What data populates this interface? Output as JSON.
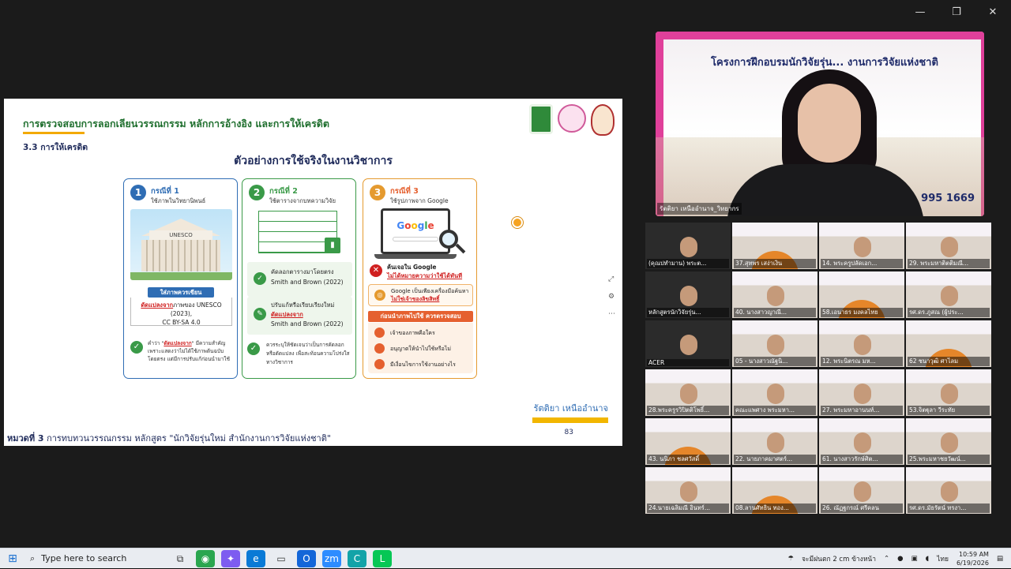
{
  "window": {
    "minimize": "—",
    "maximize": "❐",
    "close": "✕"
  },
  "slide": {
    "title": "การตรวจสอบการลอกเลียนวรรณกรรม หลักการอ้างอิง และการให้เครดิต",
    "section": "3.3 การให้เครดิต",
    "heading": "ตัวอย่างการใช้จริงในงานวิชาการ",
    "card1": {
      "num": "1",
      "title": "กรณีที่ 1",
      "subtitle": "ใช้ภาพในวิทยานิพนธ์",
      "image_text": "UNESCO",
      "label": "ใส่ภาพควรเขียน",
      "credit_red": "ดัดแปลงจาก",
      "credit_text": "ภาพของ UNESCO (2023),",
      "credit_license": "CC BY-SA 4.0",
      "note_pre": "คำว่า \"",
      "note_red": "ดัดแปลงจาก",
      "note_post": "\" มีความสำคัญ เพราะแสดงว่าไม่ได้ใช้ภาพต้นฉบับโดยตรง แต่มีการปรับแก้ก่อนนำมาใช้"
    },
    "card2": {
      "num": "2",
      "title": "กรณีที่ 2",
      "subtitle": "ใช้ตารางจากบทความวิจัย",
      "box1_line1": "คัดลอกตารางมาโดยตรง",
      "box1_line2": "Smith and Brown (2022)",
      "box2_line1": "ปรับแก้หรือเรียบเรียงใหม่",
      "box2_red": "ดัดแปลงจาก",
      "box2_line3": "Smith and Brown (2022)",
      "note": "ควรระบุให้ชัดเจนว่าเป็นการคัดลอก หรือดัดแปลง เพื่อสะท้อนความโปร่งใส ทางวิชาการ"
    },
    "card3": {
      "num": "3",
      "title": "กรณีที่ 3",
      "subtitle": "ใช้รูปภาพจาก Google",
      "google": "Google",
      "found_line1": "ค้นเจอใน Google",
      "found_line2": "ไม่ได้หมายความว่าใช้ได้ทันที",
      "box_line1": "Google เป็นเพียงเครื่องมือค้นหา",
      "box_line2": "ไม่ใช่เจ้าของลิขสิทธิ์",
      "bar": "ก่อนนำภาพไปใช้ ควรตรวจสอบ",
      "items": [
        "เจ้าของภาพคือใคร",
        "อนุญาตให้นำไปใช้หรือไม่",
        "มีเงื่อนไขการใช้งานอย่างไร"
      ]
    },
    "author": "รัตติยา เหนืออำนาจ",
    "page": "83",
    "footer_bold": "หมวดที่ 3",
    "footer_text": "การทบทวนวรรณกรรม หลักสูตร \"นักวิจัยรุ่นใหม่ สำนักงานการวิจัยแห่งชาติ\""
  },
  "speaker": {
    "banner_title": "โครงการฝึกอบรมนักวิจัยรุ่น... งานการวิจัยแห่งชาติ",
    "number": "995 1669",
    "name": "รัตติยา เหนืออำนาจ_วิทยากร"
  },
  "participants": [
    "(คุณปทำมาน) พระต...",
    "37.สุทพร เสง่าเงิน",
    "14. พระครูปลัดเอก...",
    "29. พระมหาติตติมณี...",
    "หลักสูตรนักวิจัยรุ่น...",
    "40. นางสาวญาณี...",
    "58.เอนาธร มงคลไทย",
    "รศ.ดร.ภูสณ (ผู้ประ...",
    "ACER",
    "05 - นางสาวณัฐนิ...",
    "12. พระนิตรณ มห...",
    "62 ชนาวุฒิ ศาไลม",
    "28.พระครูรวิปิตติโพธิ์...",
    "คณะแพศาง พระมหา...",
    "27. พระมหาอานนท์...",
    "53.จิตฐุลา วีระทัย",
    "43. นนิภา ชลศวัสดิ์",
    "22. นายภาคมาศตร์...",
    "61. นางสาวรักษ์ศิต...",
    "25.พระมหาชยวัฒน์...",
    "24.นายเฉลิมณี อินทร์...",
    "08.ลานศัทธิน ทอง...",
    "26. ณัฏฐกรณ์ ศรีคลน",
    "รศ.ดร.มัธรัตน์ ทรงา..."
  ],
  "taskbar": {
    "search_placeholder": "Type here to search",
    "weather": "จะมีฝนตก 2 cm ข้างหน้า",
    "lang": "ไทย",
    "time": "10:59 AM",
    "date": "6/19/2026"
  },
  "colors": {
    "primary_blue": "#2f6db4",
    "green": "#3a9a48",
    "orange": "#e59a2f",
    "pink": "#e0409a"
  }
}
